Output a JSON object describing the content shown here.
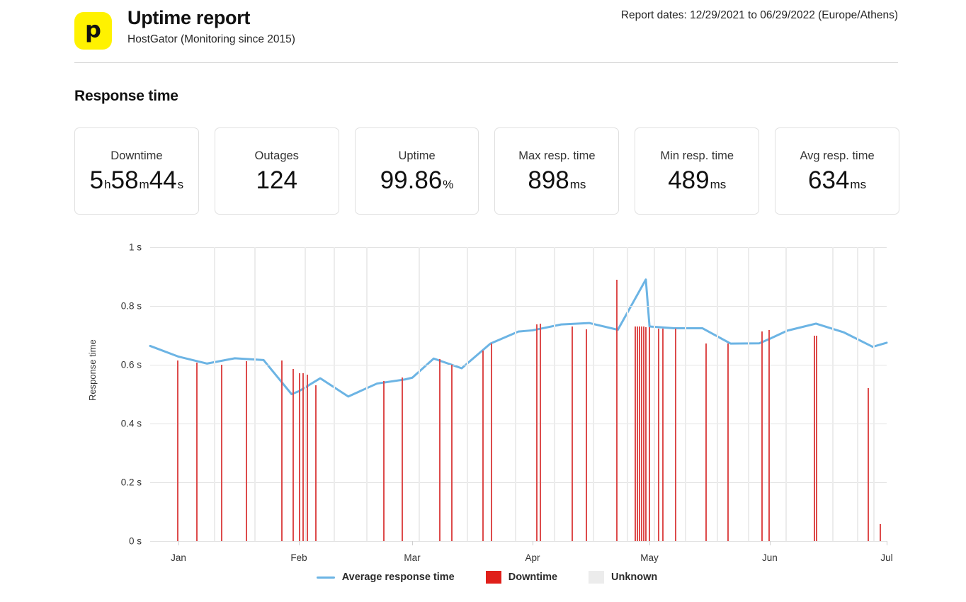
{
  "header": {
    "logo_icon": "pingdom-logo-icon",
    "logo_glyph": "p",
    "logo_color": "#FFF200",
    "title": "Uptime report",
    "subtitle": "HostGator (Monitoring since 2015)",
    "report_dates": "Report dates: 12/29/2021 to 06/29/2022 (Europe/Athens)"
  },
  "section": {
    "title": "Response time"
  },
  "stats": [
    {
      "label": "Downtime",
      "value": "5",
      "unit": "h",
      "value2": "58",
      "unit2": "m",
      "value3": "44",
      "unit3": "s"
    },
    {
      "label": "Outages",
      "value": "124",
      "unit": ""
    },
    {
      "label": "Uptime",
      "value": "99.86",
      "unit": "%"
    },
    {
      "label": "Max resp. time",
      "value": "898",
      "unit": "ms"
    },
    {
      "label": "Min resp. time",
      "value": "489",
      "unit": "ms"
    },
    {
      "label": "Avg resp. time",
      "value": "634",
      "unit": "ms"
    }
  ],
  "legend": [
    {
      "name": "average-response-time",
      "label": "Average response time",
      "type": "line",
      "color": "#6cb4e4"
    },
    {
      "name": "downtime",
      "label": "Downtime",
      "type": "box",
      "color": "#e01f1a"
    },
    {
      "name": "unknown",
      "label": "Unknown",
      "type": "box",
      "color": "#ececec"
    }
  ],
  "chart_data": {
    "type": "line",
    "title": "Response time",
    "xlabel": "",
    "ylabel": "Response time",
    "ylim": [
      0,
      1
    ],
    "yticks": [
      0,
      0.2,
      0.4,
      0.6,
      0.8,
      1
    ],
    "ytick_labels": [
      "0 s",
      "0.2 s",
      "0.4 s",
      "0.6 s",
      "0.8 s",
      "1 s"
    ],
    "grid": "horizontal",
    "legend_position": "bottom",
    "xlim": [
      "2021-12-29",
      "2022-06-29"
    ],
    "xtick_labels": [
      "Jan",
      "Feb",
      "Mar",
      "Apr",
      "May",
      "Jun",
      "Jul"
    ],
    "xtick_positions": [
      0.0385,
      0.2019,
      0.3558,
      0.5192,
      0.6779,
      0.8413,
      1.0
    ],
    "series": [
      {
        "name": "Average response time",
        "color": "#6cb4e4",
        "unit": "s",
        "x": [
          0.0,
          0.038,
          0.077,
          0.115,
          0.154,
          0.192,
          0.202,
          0.231,
          0.269,
          0.308,
          0.346,
          0.356,
          0.385,
          0.423,
          0.462,
          0.5,
          0.519,
          0.558,
          0.596,
          0.635,
          0.673,
          0.678,
          0.712,
          0.75,
          0.788,
          0.827,
          0.841,
          0.865,
          0.904,
          0.942,
          0.981,
          1.0
        ],
        "values": [
          0.664,
          0.628,
          0.604,
          0.622,
          0.616,
          0.5,
          0.51,
          0.554,
          0.492,
          0.536,
          0.55,
          0.556,
          0.621,
          0.588,
          0.672,
          0.713,
          0.717,
          0.737,
          0.742,
          0.719,
          0.89,
          0.73,
          0.724,
          0.724,
          0.672,
          0.673,
          0.688,
          0.716,
          0.74,
          0.71,
          0.661,
          0.675
        ]
      }
    ],
    "downtime_bars": [
      {
        "x": 0.0365,
        "height": 0.615
      },
      {
        "x": 0.0625,
        "height": 0.607
      },
      {
        "x": 0.0962,
        "height": 0.6
      },
      {
        "x": 0.1298,
        "height": 0.613
      },
      {
        "x": 0.1779,
        "height": 0.614
      },
      {
        "x": 0.1933,
        "height": 0.585
      },
      {
        "x": 0.2019,
        "height": 0.572
      },
      {
        "x": 0.2067,
        "height": 0.57
      },
      {
        "x": 0.2125,
        "height": 0.566
      },
      {
        "x": 0.224,
        "height": 0.531
      },
      {
        "x": 0.3163,
        "height": 0.545
      },
      {
        "x": 0.3413,
        "height": 0.556
      },
      {
        "x": 0.3923,
        "height": 0.62
      },
      {
        "x": 0.4087,
        "height": 0.6
      },
      {
        "x": 0.451,
        "height": 0.648
      },
      {
        "x": 0.4625,
        "height": 0.672
      },
      {
        "x": 0.524,
        "height": 0.737
      },
      {
        "x": 0.5288,
        "height": 0.74
      },
      {
        "x": 0.5721,
        "height": 0.73
      },
      {
        "x": 0.5913,
        "height": 0.721
      },
      {
        "x": 0.6327,
        "height": 0.89
      },
      {
        "x": 0.6577,
        "height": 0.73
      },
      {
        "x": 0.6606,
        "height": 0.73
      },
      {
        "x": 0.6635,
        "height": 0.73
      },
      {
        "x": 0.6663,
        "height": 0.73
      },
      {
        "x": 0.6692,
        "height": 0.73
      },
      {
        "x": 0.6721,
        "height": 0.728
      },
      {
        "x": 0.6769,
        "height": 0.727
      },
      {
        "x": 0.6894,
        "height": 0.724
      },
      {
        "x": 0.6952,
        "height": 0.724
      },
      {
        "x": 0.7125,
        "height": 0.722
      },
      {
        "x": 0.7538,
        "height": 0.673
      },
      {
        "x": 0.7837,
        "height": 0.672
      },
      {
        "x": 0.8298,
        "height": 0.713
      },
      {
        "x": 0.8394,
        "height": 0.718
      },
      {
        "x": 0.901,
        "height": 0.7
      },
      {
        "x": 0.9038,
        "height": 0.7
      },
      {
        "x": 0.974,
        "height": 0.52
      },
      {
        "x": 0.9904,
        "height": 0.058
      }
    ],
    "unknown_bars": [
      {
        "x": 0.0865
      },
      {
        "x": 0.1413
      },
      {
        "x": 0.2096
      },
      {
        "x": 0.249
      },
      {
        "x": 0.2933
      },
      {
        "x": 0.3644
      },
      {
        "x": 0.4298
      },
      {
        "x": 0.4952
      },
      {
        "x": 0.5481
      },
      {
        "x": 0.601
      },
      {
        "x": 0.6471
      },
      {
        "x": 0.6837
      },
      {
        "x": 0.726
      },
      {
        "x": 0.7692
      },
      {
        "x": 0.8115
      },
      {
        "x": 0.8625
      },
      {
        "x": 0.926
      },
      {
        "x": 0.9596
      },
      {
        "x": 0.9817
      }
    ]
  }
}
